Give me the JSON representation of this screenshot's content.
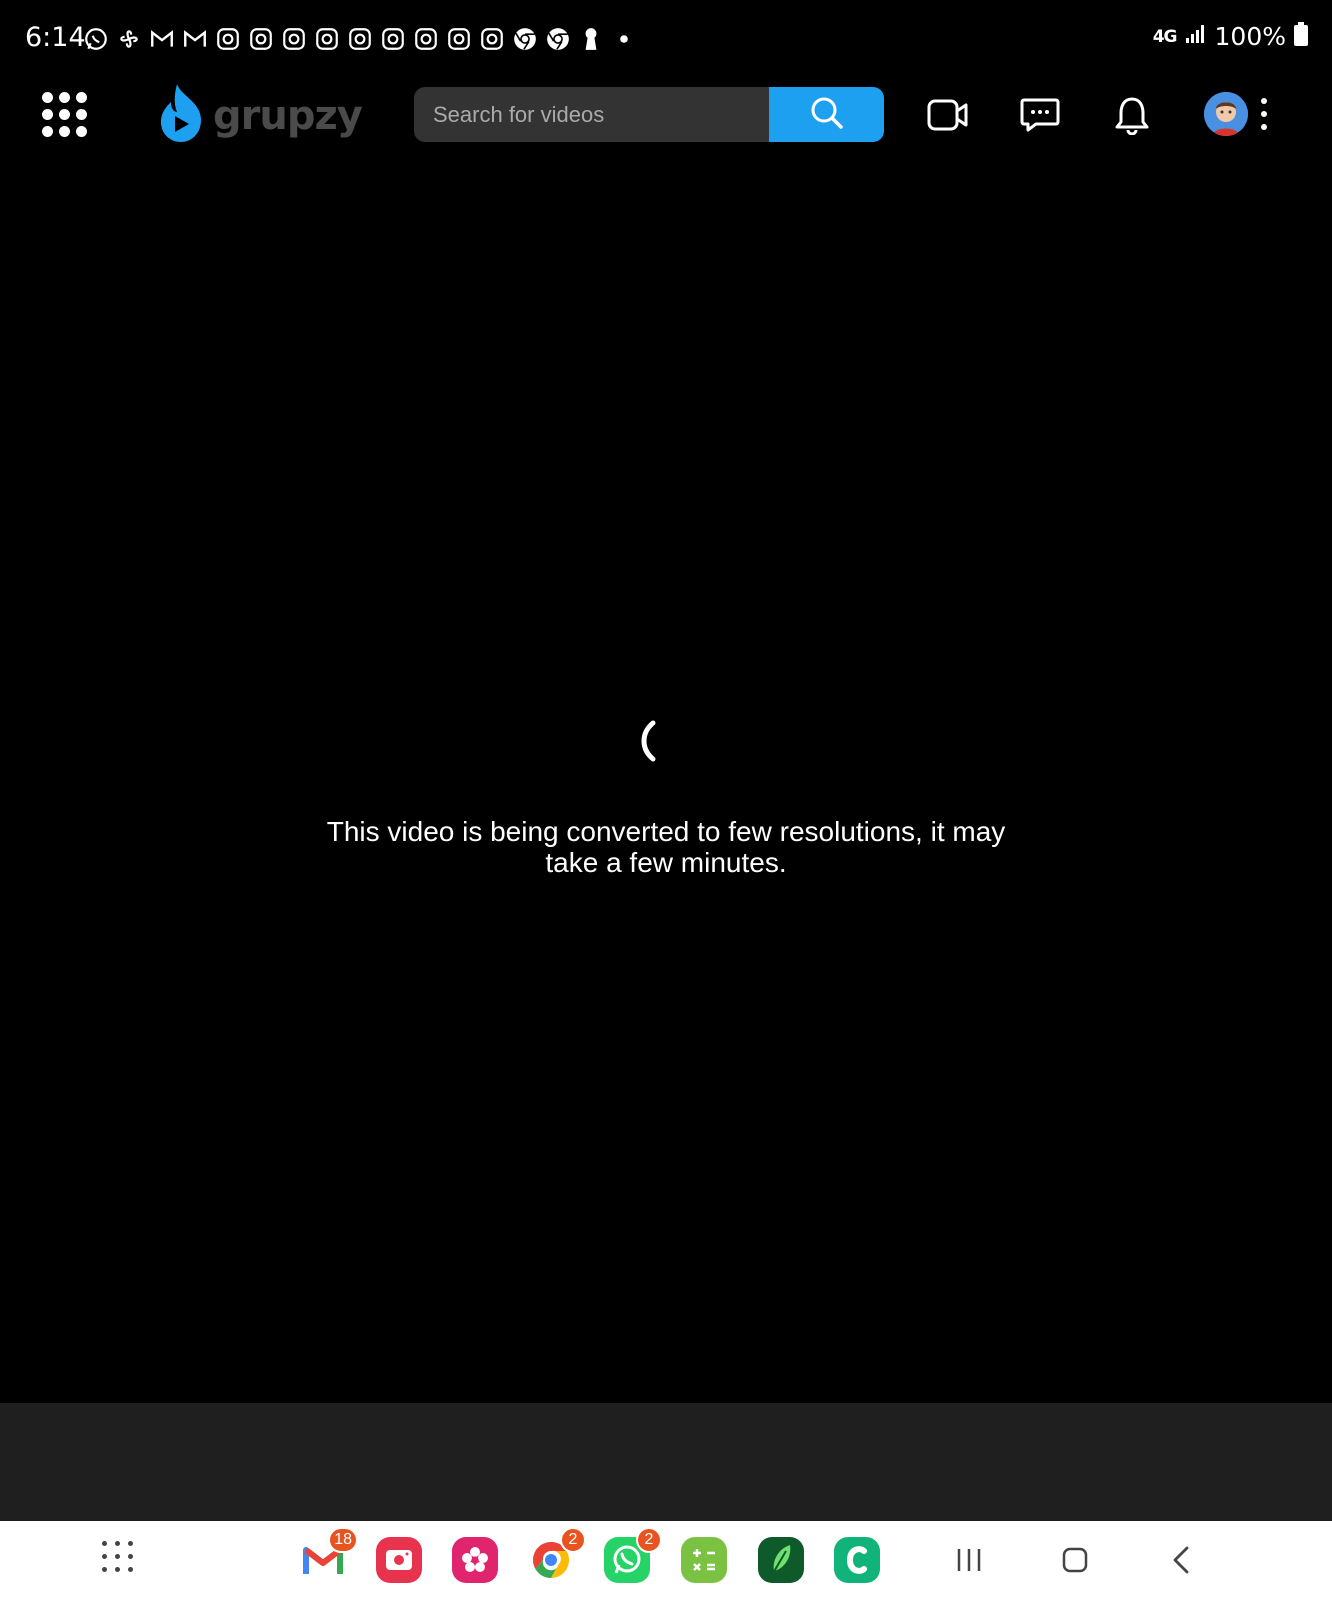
{
  "status_bar": {
    "time": "6:14",
    "notification_icons": [
      "whatsapp-icon",
      "pinwheel-icon",
      "gmail-icon",
      "gmail-icon",
      "instagram-icon",
      "instagram-icon",
      "instagram-icon",
      "instagram-icon",
      "instagram-icon",
      "instagram-icon",
      "instagram-icon",
      "instagram-icon",
      "instagram-icon",
      "chrome-icon",
      "chrome-icon",
      "keyhole-icon",
      "more-dot-icon"
    ],
    "network": "4G",
    "battery": "100%"
  },
  "header": {
    "logo_text": "grupzy",
    "search": {
      "placeholder": "Search for videos",
      "value": ""
    },
    "icons": [
      "apps-grid-icon",
      "search-icon",
      "video-camera-icon",
      "chat-icon",
      "bell-icon",
      "avatar",
      "kebab-menu-icon"
    ]
  },
  "video": {
    "message": "This video is being converted to few resolutions, it may take a few minutes."
  },
  "taskbar": {
    "apps": [
      {
        "name": "gmail",
        "badge": "18"
      },
      {
        "name": "screen-recorder",
        "badge": ""
      },
      {
        "name": "blossom",
        "badge": ""
      },
      {
        "name": "chrome",
        "badge": "2"
      },
      {
        "name": "whatsapp",
        "badge": "2"
      },
      {
        "name": "calculator",
        "badge": ""
      },
      {
        "name": "feather",
        "badge": ""
      },
      {
        "name": "c-app",
        "badge": ""
      }
    ]
  },
  "colors": {
    "accent": "#1ea0f0",
    "background": "#000000",
    "search_bg": "#333333",
    "band": "#1f1f1f",
    "badge": "#e8541f"
  }
}
